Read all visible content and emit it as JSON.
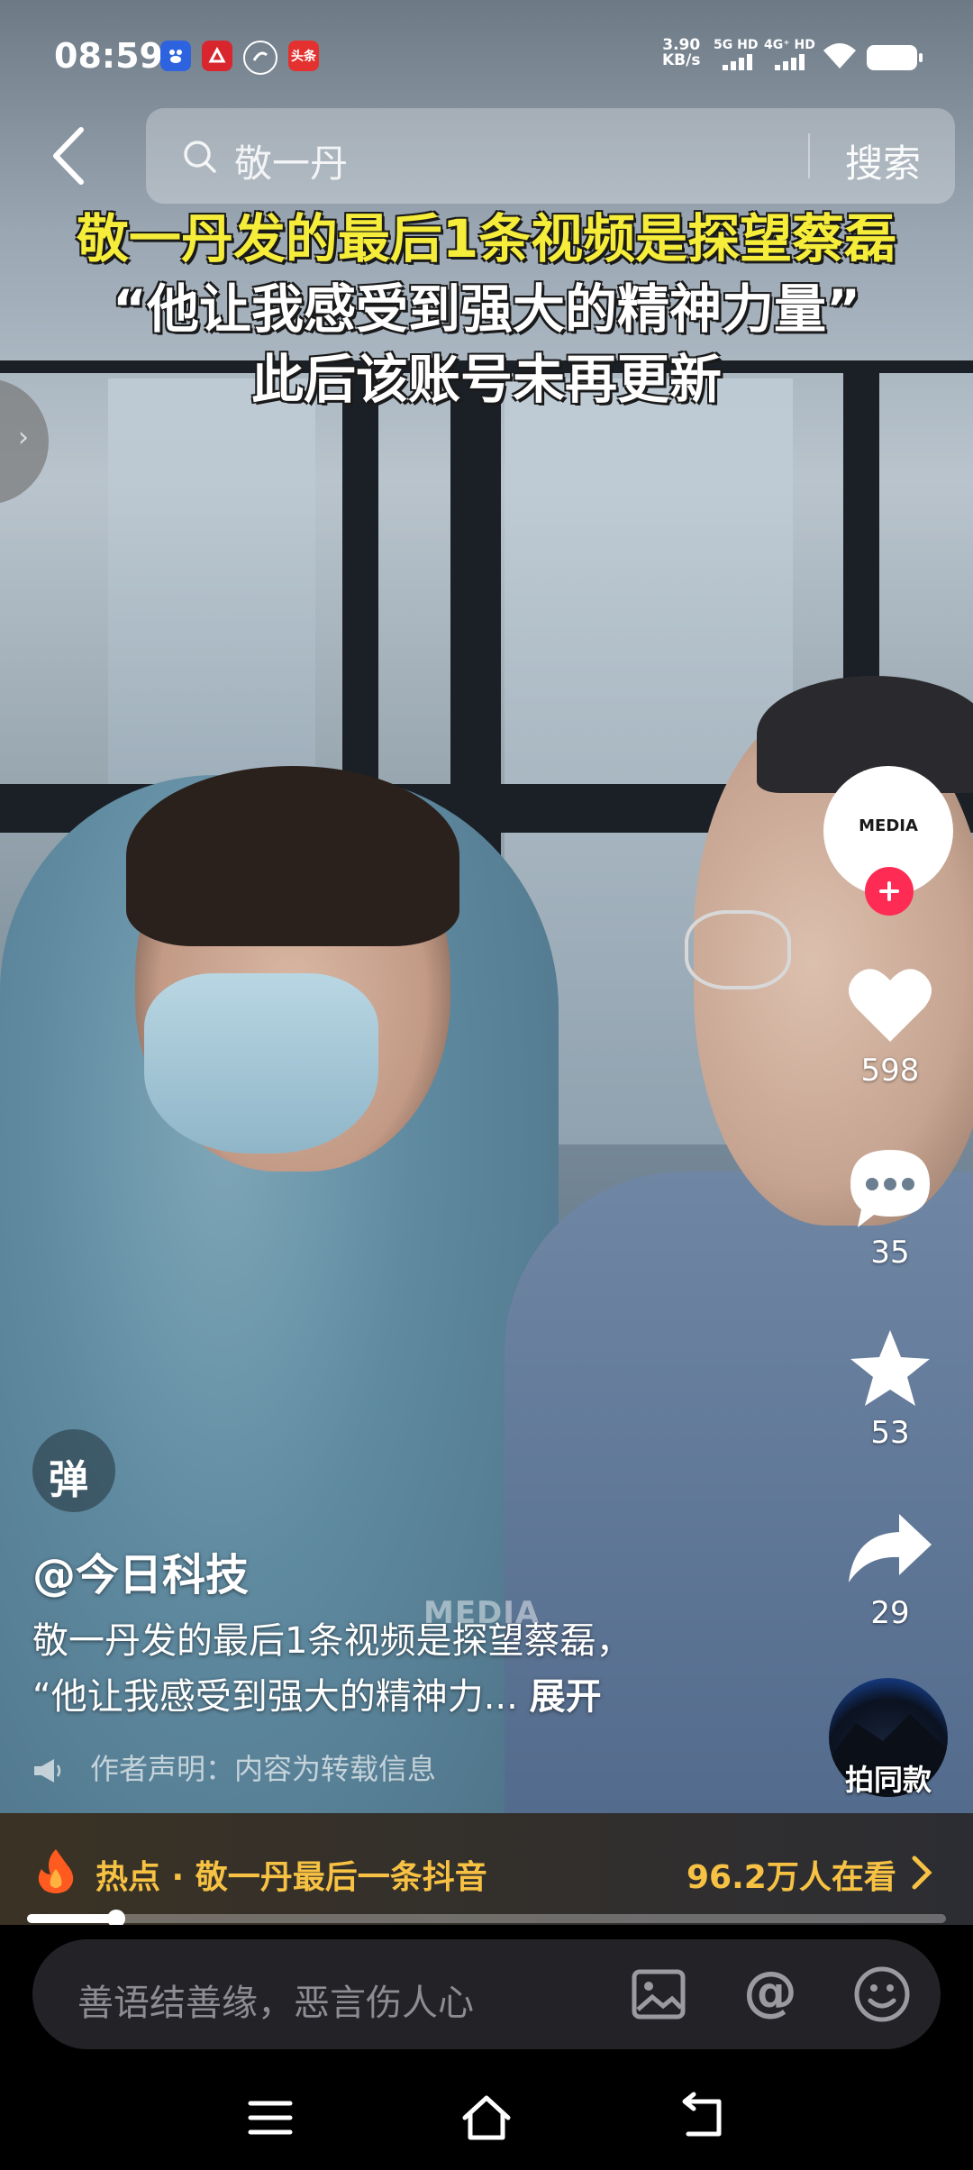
{
  "status_bar": {
    "time": "08:59",
    "app_icons": [
      {
        "name": "baidu-icon",
        "label": "",
        "color": "#2e63e0"
      },
      {
        "name": "app-red-icon",
        "label": "",
        "color": "#d9262e"
      },
      {
        "name": "app-swirl-icon",
        "label": "",
        "color": "#ffffff"
      },
      {
        "name": "toutiao-icon",
        "label": "头条",
        "color": "#e3312f"
      }
    ],
    "net_speed_value": "3.90",
    "net_speed_unit": "KB/s",
    "sim1": "5G HD",
    "sim2": "4G⁺ HD"
  },
  "search": {
    "query": "敬一丹",
    "button": "搜索"
  },
  "video_caption": {
    "line1": "敬一丹发的最后1条视频是探望蔡磊",
    "line2": "“他让我感受到强大的精神力量”",
    "line3": "此后该账号未再更新"
  },
  "watermark": "MEDIA",
  "rail": {
    "avatar_logo": "MEDIA",
    "likes": "598",
    "comments": "35",
    "favorites": "53",
    "shares": "29",
    "same_style": "拍同款"
  },
  "danmu_label": "弹",
  "author": "@今日科技",
  "description": {
    "line1": "敬一丹发的最后1条视频是探望蔡磊，",
    "line2": "“他让我感受到强大的精神力...",
    "expand": "展开"
  },
  "declaration": "作者声明：内容为转载信息",
  "hot": {
    "text": "热点 · 敬一丹最后一条抖音",
    "viewers": "96.2万人在看",
    "color": "#f7c243"
  },
  "progress": 0.097,
  "comment": {
    "placeholder": "善语结善缘，恶言伤人心"
  },
  "colors": {
    "follow": "#fe2c55",
    "caption_yellow": "#f5ed3a"
  }
}
